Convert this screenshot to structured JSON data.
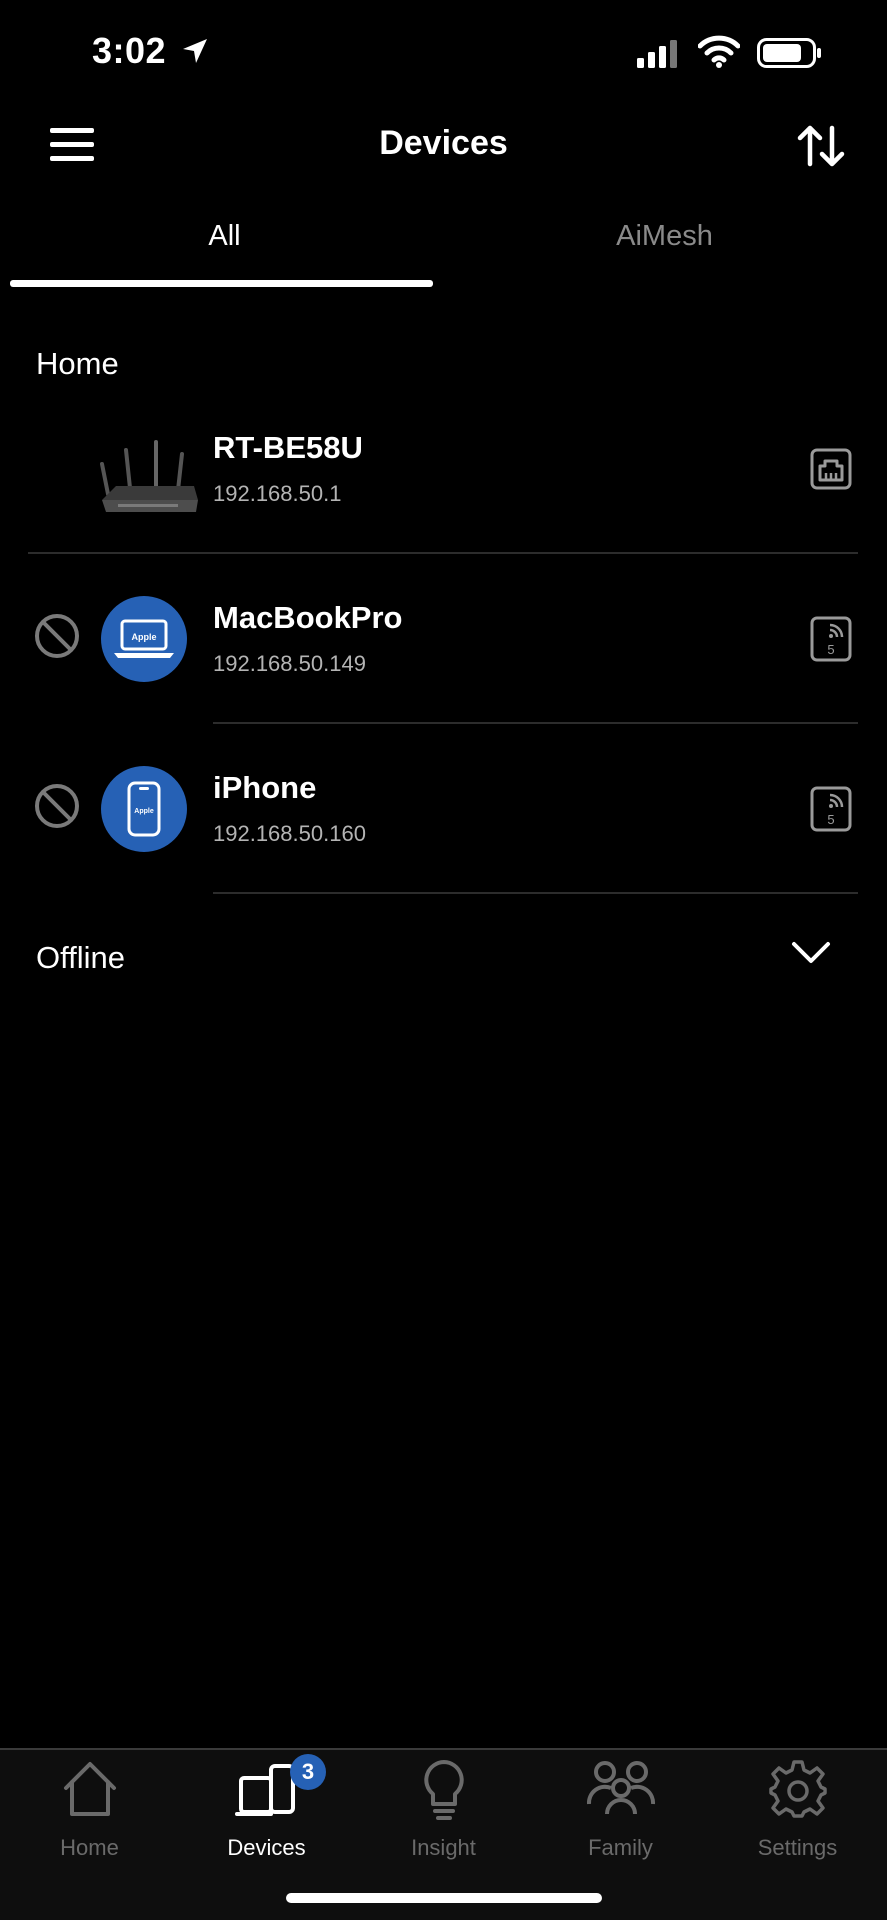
{
  "status_bar": {
    "time": "3:02"
  },
  "header": {
    "title": "Devices"
  },
  "tabs": [
    {
      "label": "All",
      "active": true
    },
    {
      "label": "AiMesh",
      "active": false
    }
  ],
  "sections": {
    "home": {
      "title": "Home"
    },
    "offline": {
      "title": "Offline"
    }
  },
  "devices": [
    {
      "name": "RT-BE58U",
      "ip": "192.168.50.1",
      "icon": "router-image",
      "connection": "ethernet-icon"
    },
    {
      "name": "MacBookPro",
      "ip": "192.168.50.149",
      "icon": "laptop-icon",
      "brand_label": "Apple",
      "connection": "wifi-5ghz-icon",
      "band": "5"
    },
    {
      "name": "iPhone",
      "ip": "192.168.50.160",
      "icon": "phone-icon",
      "brand_label": "Apple",
      "connection": "wifi-5ghz-icon",
      "band": "5"
    }
  ],
  "bottom_nav": {
    "items": [
      {
        "label": "Home",
        "icon": "home-icon",
        "active": false
      },
      {
        "label": "Devices",
        "icon": "devices-icon",
        "active": true,
        "badge": "3"
      },
      {
        "label": "Insight",
        "icon": "lightbulb-icon",
        "active": false
      },
      {
        "label": "Family",
        "icon": "family-icon",
        "active": false
      },
      {
        "label": "Settings",
        "icon": "gear-icon",
        "active": false
      }
    ]
  },
  "colors": {
    "background": "#000000",
    "accent": "#2661b5",
    "inactive": "#6a6a6a"
  }
}
